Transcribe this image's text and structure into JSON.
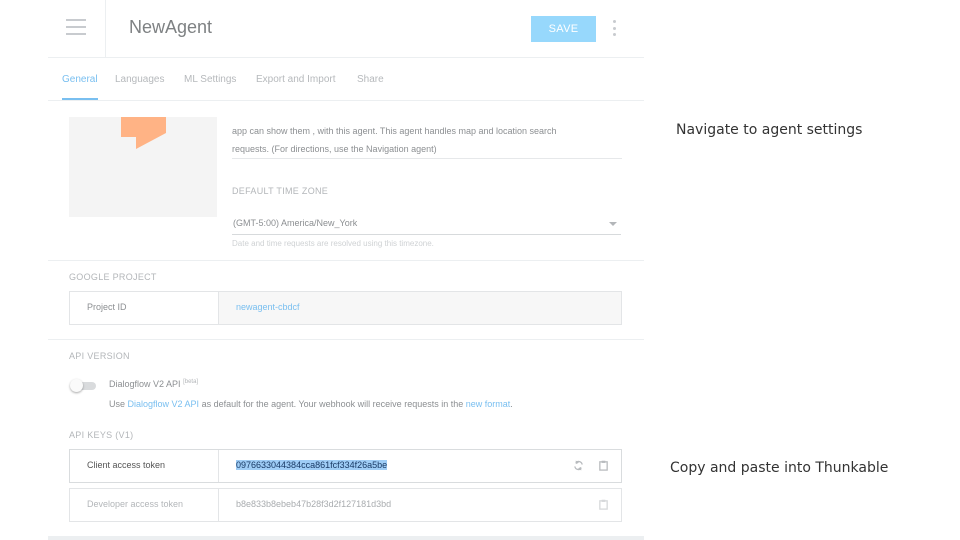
{
  "header": {
    "agent_name": "NewAgent",
    "save_label": "SAVE"
  },
  "tabs": [
    {
      "label": "General",
      "active": true
    },
    {
      "label": "Languages",
      "active": false
    },
    {
      "label": "ML Settings",
      "active": false
    },
    {
      "label": "Export and Import",
      "active": false
    },
    {
      "label": "Share",
      "active": false
    }
  ],
  "general": {
    "description_line1": "app can show them , with this agent. This agent handles map and location search",
    "description_line2": "requests. (For directions, use the Navigation agent)",
    "time_zone_label": "DEFAULT TIME ZONE",
    "time_zone_value": "(GMT-5:00) America/New_York",
    "time_zone_help": "Date and time requests are resolved using this timezone."
  },
  "google_project": {
    "section_label": "GOOGLE PROJECT",
    "project_id_label": "Project ID",
    "project_id_value": "newagent-cbdcf"
  },
  "api_version": {
    "section_label": "API VERSION",
    "v2_label": "Dialogflow V2 API",
    "v2_badge": "[beta]",
    "desc_prefix": "Use ",
    "desc_link": "Dialogflow V2 API",
    "desc_middle": " as default for the agent. Your webhook will receive requests in the ",
    "desc_link2": "new format",
    "desc_suffix": "."
  },
  "api_keys": {
    "section_label": "API KEYS (V1)",
    "client_label": "Client access token",
    "client_token": "0976633044384cca861fcf334f26a5be",
    "developer_label": "Developer access token",
    "developer_token": "b8e833b8ebeb47b28f3d2f127181d3bd"
  },
  "notes": {
    "note1": "Navigate to agent settings",
    "note2": "Copy and paste into Thunkable"
  },
  "colors": {
    "accent": "#79bff0",
    "save_button": "#97d8fc",
    "selection": "#9fcdf6",
    "avatar_orange": "#ffb385"
  }
}
